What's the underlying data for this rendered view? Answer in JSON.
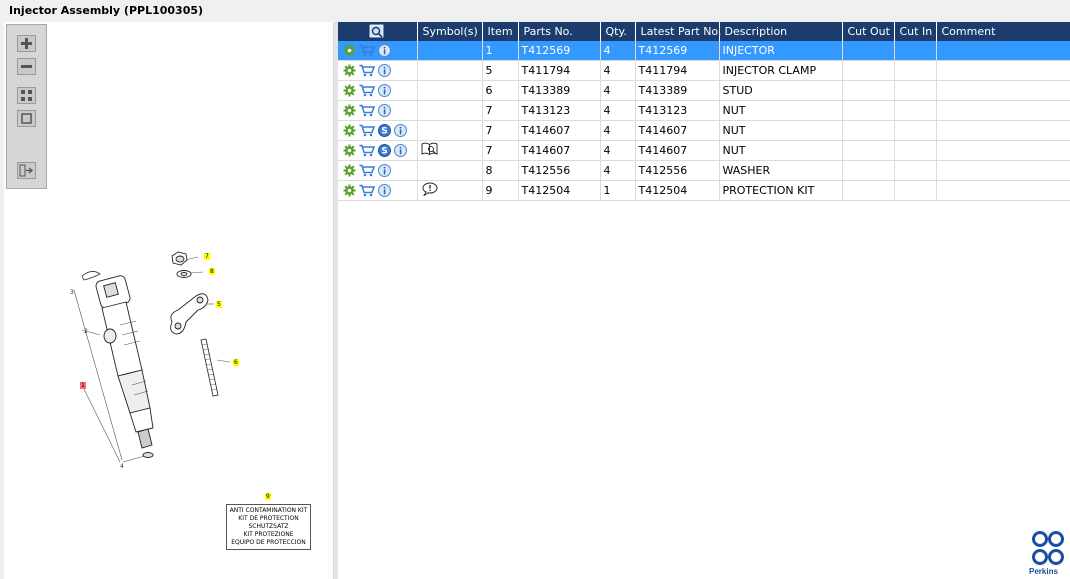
{
  "window": {
    "title": "Injector Assembly (PPL100305)"
  },
  "columns": {
    "symbols": "Symbol(s)",
    "item": "Item",
    "parts_no": "Parts No.",
    "qty": "Qty.",
    "latest_part_no": "Latest Part No.",
    "description": "Description",
    "cut_out": "Cut Out",
    "cut_in": "Cut In",
    "comment": "Comment"
  },
  "rows": [
    {
      "item": "1",
      "parts_no": "T412569",
      "qty": "4",
      "latest_part_no": "T412569",
      "description": "INJECTOR",
      "selected": true,
      "service_icon": false,
      "symbol": ""
    },
    {
      "item": "5",
      "parts_no": "T411794",
      "qty": "4",
      "latest_part_no": "T411794",
      "description": "INJECTOR CLAMP",
      "selected": false,
      "service_icon": false,
      "symbol": ""
    },
    {
      "item": "6",
      "parts_no": "T413389",
      "qty": "4",
      "latest_part_no": "T413389",
      "description": "STUD",
      "selected": false,
      "service_icon": false,
      "symbol": ""
    },
    {
      "item": "7",
      "parts_no": "T413123",
      "qty": "4",
      "latest_part_no": "T413123",
      "description": "NUT",
      "selected": false,
      "service_icon": false,
      "symbol": ""
    },
    {
      "item": "7",
      "parts_no": "T414607",
      "qty": "4",
      "latest_part_no": "T414607",
      "description": "NUT",
      "selected": false,
      "service_icon": true,
      "symbol": ""
    },
    {
      "item": "7",
      "parts_no": "T414607",
      "qty": "4",
      "latest_part_no": "T414607",
      "description": "NUT",
      "selected": false,
      "service_icon": true,
      "symbol": "book-icon"
    },
    {
      "item": "8",
      "parts_no": "T412556",
      "qty": "4",
      "latest_part_no": "T412556",
      "description": "WASHER",
      "selected": false,
      "service_icon": false,
      "symbol": ""
    },
    {
      "item": "9",
      "parts_no": "T412504",
      "qty": "1",
      "latest_part_no": "T412504",
      "description": "PROTECTION KIT",
      "selected": false,
      "service_icon": false,
      "symbol": "comment-icon"
    }
  ],
  "diagram": {
    "callouts": [
      "7",
      "8",
      "5",
      "6",
      "3",
      "2",
      "1",
      "4",
      "9"
    ],
    "kit_lines": [
      "ANTI CONTAMINATION KIT",
      "KIT DE PROTECTION",
      "SCHUTZSATZ",
      "KIT PROTEZIONE",
      "EQUIPO DE PROTECCION"
    ]
  },
  "brand": {
    "name": "Perkins",
    "color": "#1c4fa0"
  },
  "colors": {
    "header": "#1c3c6e",
    "selected_row": "#3399ff"
  }
}
